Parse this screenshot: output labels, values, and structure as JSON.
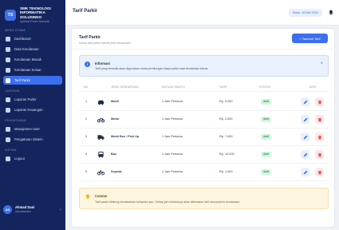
{
  "brand": {
    "logo": "TS",
    "name_line1": "SMK TEKNOLOGI",
    "name_line2": "INFORMATIKA SOLUSINDO",
    "subtitle": "Aplikasi Parkir Sekolah"
  },
  "sidebar": {
    "sections": [
      {
        "title": "MENU UTAMA",
        "items": [
          {
            "label": "Dashboard",
            "icon": "dashboard-icon",
            "active": false
          },
          {
            "label": "Data Kendaraan",
            "icon": "car-icon",
            "active": false
          },
          {
            "label": "Kendaraan Masuk",
            "icon": "arrow-in-icon",
            "active": false
          },
          {
            "label": "Kendaraan Keluar",
            "icon": "arrow-out-icon",
            "active": false
          },
          {
            "label": "Tarif Parkir",
            "icon": "tag-icon",
            "active": true
          }
        ]
      },
      {
        "title": "LAPORAN",
        "items": [
          {
            "label": "Laporan Parkir",
            "icon": "report-icon",
            "active": false
          },
          {
            "label": "Laporan Keuangan",
            "icon": "money-icon",
            "active": false
          }
        ]
      },
      {
        "title": "PENGATURAN",
        "items": [
          {
            "label": "Manajemen User",
            "icon": "users-icon",
            "active": false
          },
          {
            "label": "Pengaturan Sistem",
            "icon": "gear-icon",
            "active": false
          }
        ]
      },
      {
        "title": "SISTEM",
        "items": [
          {
            "label": "Logout",
            "icon": "logout-icon",
            "active": false
          }
        ]
      }
    ]
  },
  "user": {
    "initials": "AD",
    "name": "Ahmad Dani",
    "role": "Administrator"
  },
  "header": {
    "title": "Tarif Parkir",
    "date": "Rabu, 15 Mei 2024"
  },
  "card": {
    "title": "Tarif Parkir",
    "subtitle": "Kelola tarif parkir sesuai jenis kendaraan",
    "add_label": "+ Tambah Tarif"
  },
  "info": {
    "title": "Informasi",
    "text": "Tarif yang tersedia akan digunakan untuk perhitungan biaya parkir saat kendaraan keluar."
  },
  "table": {
    "headers": [
      "NO",
      "JENIS KENDARAAN",
      "SATUAN WAKTU",
      "TARIF",
      "STATUS",
      "AKSI"
    ],
    "rows": [
      {
        "no": "1",
        "vehicle": "Mobil",
        "vehicle_icon": "car-icon",
        "unit": "1 Jam Pertama",
        "rate": "Rp. 5.000",
        "status": "Aktif"
      },
      {
        "no": "2",
        "vehicle": "Motor",
        "vehicle_icon": "motorcycle-icon",
        "unit": "1 Jam Pertama",
        "rate": "Rp. 2.000",
        "status": "Aktif"
      },
      {
        "no": "3",
        "vehicle": "Mobil Box / Pick Up",
        "vehicle_icon": "truck-icon",
        "unit": "1 Jam Pertama",
        "rate": "Rp. 7.000",
        "status": "Aktif"
      },
      {
        "no": "4",
        "vehicle": "Bus",
        "vehicle_icon": "bus-icon",
        "unit": "1 Jam Pertama",
        "rate": "Rp. 10.000",
        "status": "Aktif"
      },
      {
        "no": "5",
        "vehicle": "Sepeda",
        "vehicle_icon": "bicycle-icon",
        "unit": "1 Jam Pertama",
        "rate": "Rp. 1.000",
        "status": "Aktif"
      }
    ]
  },
  "note": {
    "title": "Catatan",
    "text": "Tarif parkir dihitung berdasarkan kelipatan jam. Setiap jam berikutnya akan dikenakan tarif sesuai jenis kendaraan."
  },
  "colors": {
    "sidebar": "#13255c",
    "accent": "#3b6ff0",
    "status_active": "#1f9a52",
    "danger": "#e25555"
  }
}
